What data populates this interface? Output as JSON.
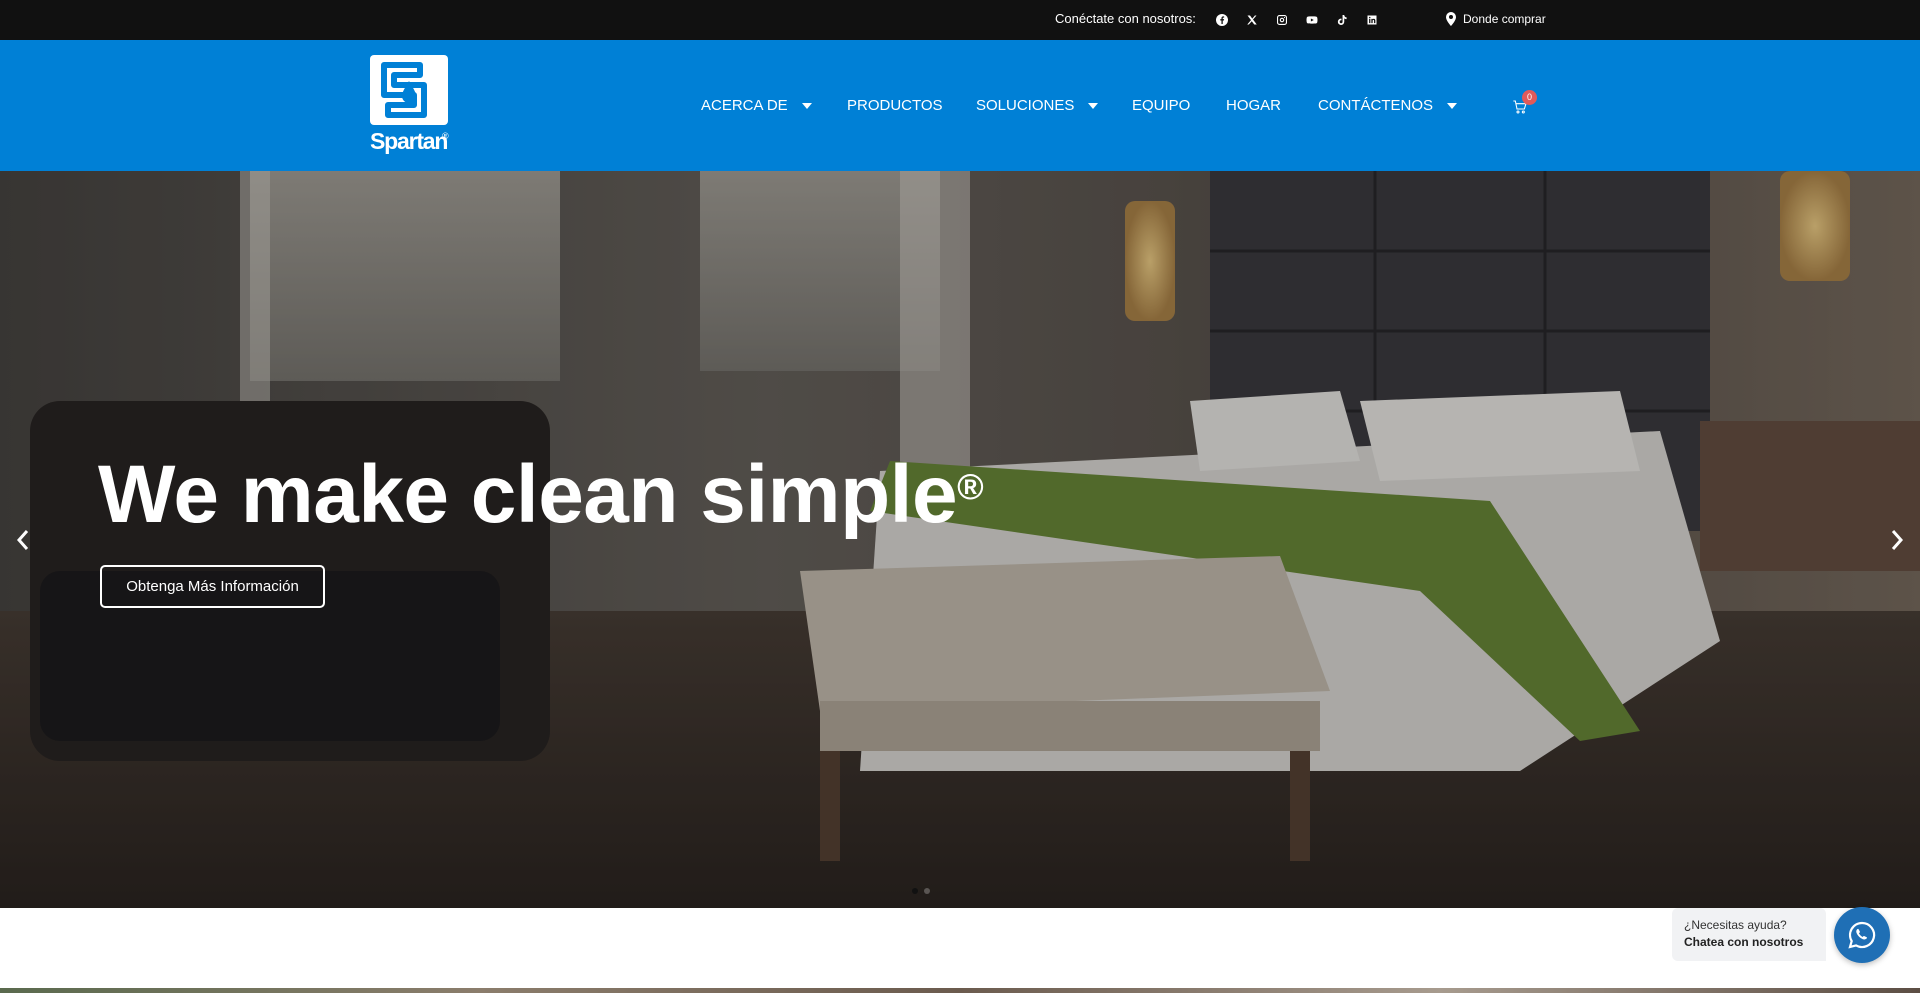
{
  "topbar": {
    "connect_label": "Conéctate con nosotros:",
    "social_icons": [
      "facebook-icon",
      "x-icon",
      "instagram-icon",
      "youtube-icon",
      "tiktok-icon",
      "linkedin-icon"
    ],
    "where_label": "Donde comprar"
  },
  "header": {
    "logo_text": "Spartan",
    "logo_reg": "®",
    "nav": [
      {
        "label": "ACERCA DE",
        "dropdown": true
      },
      {
        "label": "PRODUCTOS",
        "dropdown": false
      },
      {
        "label": "SOLUCIONES",
        "dropdown": true
      },
      {
        "label": "EQUIPO",
        "dropdown": false
      },
      {
        "label": "HOGAR",
        "dropdown": false
      },
      {
        "label": "CONTÁCTENOS",
        "dropdown": true
      }
    ],
    "cart_count": "0"
  },
  "hero": {
    "headline": "We make clean simple",
    "headline_mark": "®",
    "cta_label": "Obtenga Más Información",
    "slides": 2,
    "active_slide": 1
  },
  "chat": {
    "question": "¿Necesitas ayuda?",
    "action": "Chatea con nosotros"
  },
  "colors": {
    "topbar_bg": "#111111",
    "header_bg": "#0080d6",
    "cart_badge": "#e05a5a",
    "chat_button": "#1f6fb5"
  }
}
